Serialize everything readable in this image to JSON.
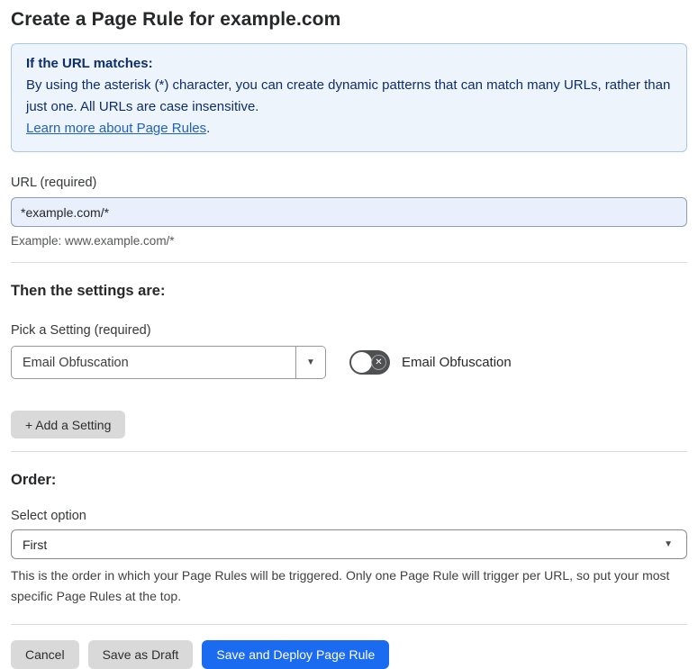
{
  "page": {
    "title": "Create a Page Rule for example.com"
  },
  "info_box": {
    "heading": "If the URL matches:",
    "body": "By using the asterisk (*) character, you can create dynamic patterns that can match many URLs, rather than just one. All URLs are case insensitive.",
    "link_label": "Learn more about Page Rules",
    "link_suffix": "."
  },
  "url_field": {
    "label": "URL (required)",
    "value": "*example.com/*",
    "example": "Example: www.example.com/*"
  },
  "settings_section": {
    "heading": "Then the settings are:",
    "picker_label": "Pick a Setting (required)",
    "picker_value": "Email Obfuscation",
    "toggle_state": "off",
    "toggle_label": "Email Obfuscation",
    "add_setting_label": "+ Add a Setting"
  },
  "order_section": {
    "heading": "Order:",
    "select_label": "Select option",
    "select_value": "First",
    "help_text": "This is the order in which your Page Rules will be triggered. Only one Page Rule will trigger per URL, so put your most specific Page Rules at the top."
  },
  "footer": {
    "cancel_label": "Cancel",
    "save_draft_label": "Save as Draft",
    "save_deploy_label": "Save and Deploy Page Rule"
  },
  "icons": {
    "dropdown_arrow": "▼",
    "select_chevron": "▼",
    "toggle_off_x": "✕"
  },
  "colors": {
    "info_background": "#EDF4FB",
    "info_border": "#A9C7E6",
    "info_text": "#0D2E6D",
    "link_blue": "#2061C5",
    "input_background": "#E9F0FB",
    "primary_button_blue": "#1B6BF1",
    "gray_button": "#D9D9D9",
    "toggle_off_gray": "#4E5152"
  }
}
